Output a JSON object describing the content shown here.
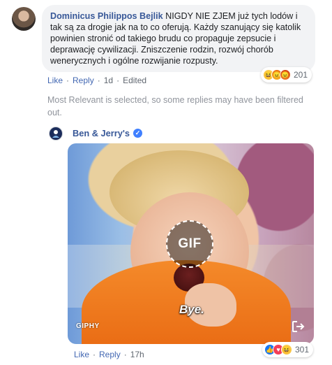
{
  "comment": {
    "author": "Dominicus Philippos Bejlik",
    "text": "NIGDY NIE ZJEM już tych lodów i tak są za drogie jak na to co oferują. Każdy szanujący się katolik powinien stronić od takiego brudu co propaguje zepsucie i deprawację cywilizacji. Zniszczenie rodzin, rozwój chorób wenerycznych i ogólne rozwijanie rozpusty.",
    "reaction_count": "201",
    "actions": {
      "like": "Like",
      "reply": "Reply",
      "time": "1d",
      "edited": "Edited"
    }
  },
  "notice": "Most Relevant is selected, so some replies may have been filtered out.",
  "reply": {
    "author": "Ben & Jerry's",
    "verified_icon": "verified-check-icon",
    "gif": {
      "badge": "GIF",
      "caption": "Bye.",
      "provider": "GIPHY"
    },
    "reaction_count": "301",
    "actions": {
      "like": "Like",
      "reply": "Reply",
      "time": "17h"
    }
  },
  "colors": {
    "link": "#385898",
    "action_link": "#4267b2",
    "bubble": "#f2f3f5",
    "muted": "#90949c"
  }
}
